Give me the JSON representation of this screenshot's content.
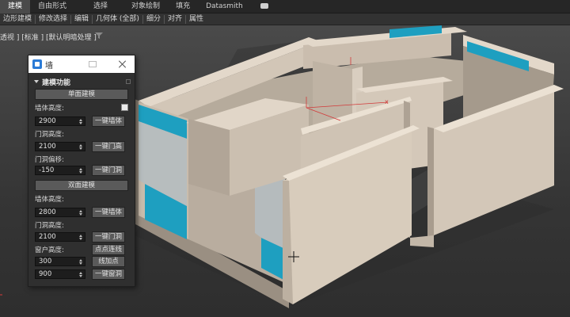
{
  "ribbon": {
    "tabs": [
      {
        "label": "建模",
        "active": true
      },
      {
        "label": "自由形式",
        "active": false
      },
      {
        "label": "选择",
        "active": false
      },
      {
        "label": "对象绘制",
        "active": false
      },
      {
        "label": "填充",
        "active": false
      },
      {
        "label": "Datasmith",
        "active": false
      }
    ]
  },
  "subtoolbar": {
    "items": [
      "边形建模",
      "修改选择",
      "编辑",
      "几何体 (全部)",
      "细分",
      "对齐",
      "属性"
    ]
  },
  "viewport": {
    "label": "透视 ] [标准 ] [默认明暗处理 ]"
  },
  "panel": {
    "title": "墙",
    "rollout_title": "建模功能",
    "single_section_button": "单面建模",
    "wall_height_label": "墙体高度:",
    "wall_height_value": "2900",
    "one_key_wall_button": "一键墙体",
    "door_height_label": "门洞高度:",
    "door_height_value": "2100",
    "one_key_door_button": "一键门高",
    "door_offset_label": "门洞偏移:",
    "door_offset_value": "-150",
    "one_key_door_opening_button": "一键门洞",
    "double_section_button": "双面建模",
    "wall_height2_label": "墙体高度:",
    "wall_height2_value": "2800",
    "one_key_wall2_button": "一键墙体",
    "door_height2_label": "门洞高度:",
    "door_height2_value": "2100",
    "one_key_door_opening2_button": "一键门洞",
    "window_height_label": "窗户高度:",
    "point_connect_button": "点点连线",
    "window_sill_value": "300",
    "line_add_point_button": "线加点",
    "window_height_value": "900",
    "one_key_window_button": "一键窗洞"
  },
  "colors": {
    "wall": "#cdbfb0",
    "window_blue": "#1e9fc0",
    "ribbon_bg": "#262626",
    "viewport_bg": "#3d3d3d"
  }
}
